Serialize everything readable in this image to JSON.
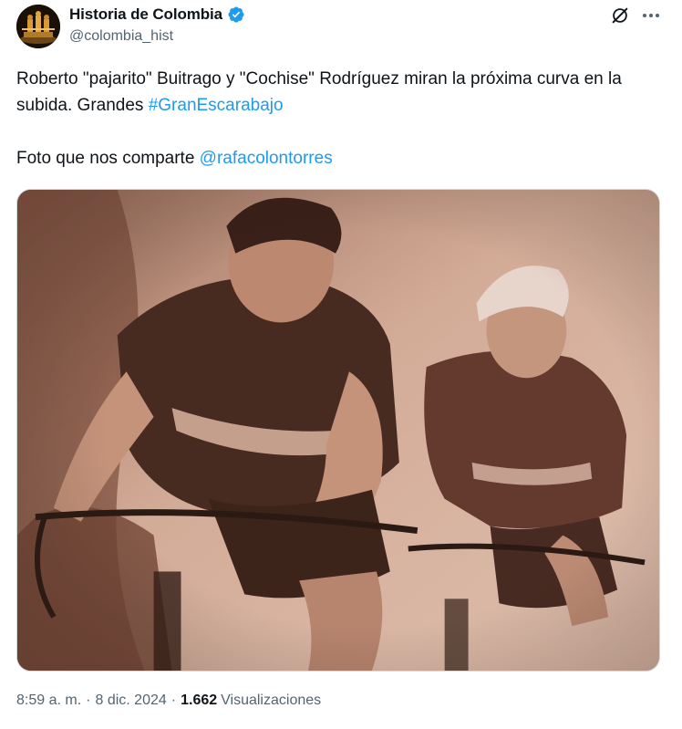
{
  "author": {
    "display_name": "Historia de Colombia",
    "handle": "@colombia_hist",
    "verified": true,
    "avatar_icon": "gold-artifact-avatar"
  },
  "header_actions": {
    "grok_icon": "grok-icon",
    "more_icon": "more-dots-icon"
  },
  "tweet": {
    "text_part1": "Roberto \"pajarito\" Buitrago y \"Cochise\" Rodríguez miran la próxima curva en la subida. Grandes ",
    "hashtag": "#GranEscarabajo",
    "text_part2": "Foto que nos comparte ",
    "mention": "@rafacolontorres"
  },
  "media": {
    "kind": "sepia photo",
    "tint": "#c49a83"
  },
  "meta": {
    "time": "8:59 a. m.",
    "separator": "·",
    "date": "8 dic. 2024",
    "views_count": "1.662",
    "views_label": "Visualizaciones"
  },
  "colors": {
    "text": "#0f1419",
    "secondary": "#536471",
    "link": "#1d9bf0",
    "verified": "#1d9bf0"
  }
}
